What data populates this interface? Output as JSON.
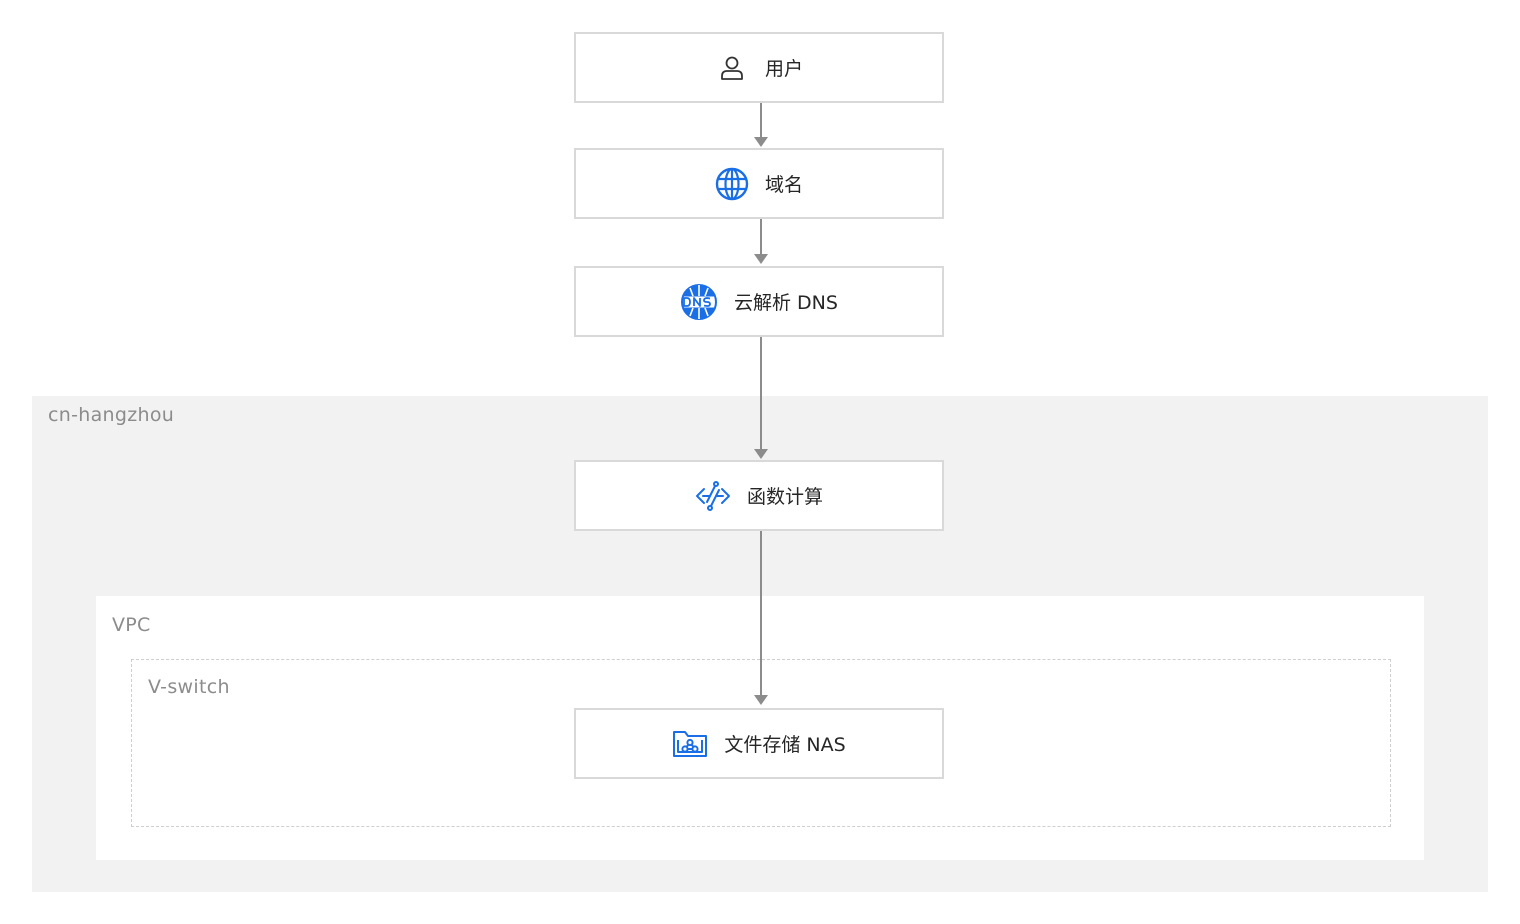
{
  "zones": {
    "region": "cn-hangzhou",
    "vpc": "VPC",
    "vswitch": "V-switch"
  },
  "nodes": {
    "user": {
      "label": "用户",
      "icon": "user-icon"
    },
    "domain": {
      "label": "域名",
      "icon": "globe-icon"
    },
    "dns": {
      "label": "云解析 DNS",
      "icon": "dns-icon"
    },
    "fc": {
      "label": "函数计算",
      "icon": "function-compute-icon"
    },
    "nas": {
      "label": "文件存储 NAS",
      "icon": "nas-storage-icon"
    }
  },
  "colors": {
    "accent": "#1a6fe6",
    "edge": "#8c8c8c",
    "region_bg": "#f2f2f2",
    "node_border": "#d9d9d9"
  }
}
